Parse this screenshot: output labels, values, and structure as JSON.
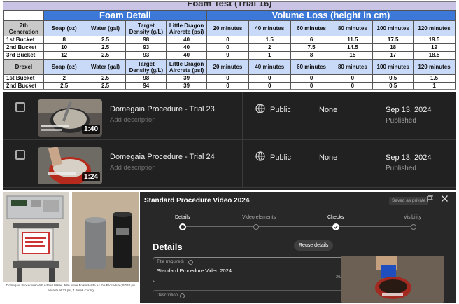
{
  "sheet": {
    "title": "Foam Test (Trial 16)",
    "group_foam": "Foam Detail",
    "group_volume": "Volume Loss (height in cm)",
    "section1_label": "7th Generation",
    "section2_label": "Drexel",
    "columns": [
      "Soap (oz)",
      "Water (gal)",
      "Target Density (g/L)",
      "Little Dragon Aircrete (psi)",
      "20 minutes",
      "40 minutes",
      "60 minutes",
      "80 minutes",
      "100 minutes",
      "120 minutes"
    ],
    "section1_rows": [
      {
        "label": "1st Bucket",
        "cells": [
          "8",
          "2.5",
          "98",
          "40",
          "0",
          "1.5",
          "6",
          "11.5",
          "17.5",
          "19.5"
        ]
      },
      {
        "label": "2nd Bucket",
        "cells": [
          "10",
          "2.5",
          "93",
          "40",
          "0",
          "2",
          "7.5",
          "14.5",
          "18",
          "19"
        ]
      },
      {
        "label": "3rd Bucket",
        "cells": [
          "12",
          "2.5",
          "93",
          "40",
          "9",
          "1",
          "8",
          "15",
          "17",
          "18.5"
        ]
      }
    ],
    "section2_rows": [
      {
        "label": "1st Bucket",
        "cells": [
          "2",
          "2.5",
          "98",
          "39",
          "0",
          "0",
          "0",
          "0",
          "0.5",
          "1.5"
        ]
      },
      {
        "label": "2nd Bucket",
        "cells": [
          "2.5",
          "2.5",
          "94",
          "39",
          "0",
          "0",
          "0",
          "0",
          "0.5",
          "1"
        ]
      }
    ]
  },
  "videos": [
    {
      "title": "Domegaia Procedure - Trial 23",
      "description": "Add description",
      "duration": "1:40",
      "visibility": "Public",
      "restrictions": "None",
      "date": "Sep 13, 2024",
      "status": "Published"
    },
    {
      "title": "Domegaia Procedure - Trial 24",
      "description": "Add description",
      "duration": "1:24",
      "visibility": "Public",
      "restrictions": "None",
      "date": "Sep 13, 2024",
      "status": "Published"
    }
  ],
  "photos": {
    "caption": "Domegaia Procedure With Added Water, 30% More Foam Made As the Procedure; 97/40 psi aircrete at 22 psi, 4 Week Curing"
  },
  "dialog": {
    "title": "Standard Procedure Video 2024",
    "saved_label": "Saved as private",
    "steps": [
      "Details",
      "Video elements",
      "Checks",
      "Visibility"
    ],
    "heading": "Details",
    "reuse_label": "Reuse details",
    "title_field_label": "Title (required)",
    "title_field_value": "Standard Procedure Video 2024",
    "title_counter": "29/100",
    "description_label": "Description"
  },
  "colors": {
    "sheet_header": "#3c78d8",
    "sheet_subheader": "#c9daf8",
    "sheet_title_bg": "#c9c4e6",
    "dark_bg": "#212121",
    "dialog_bg": "#282828"
  }
}
